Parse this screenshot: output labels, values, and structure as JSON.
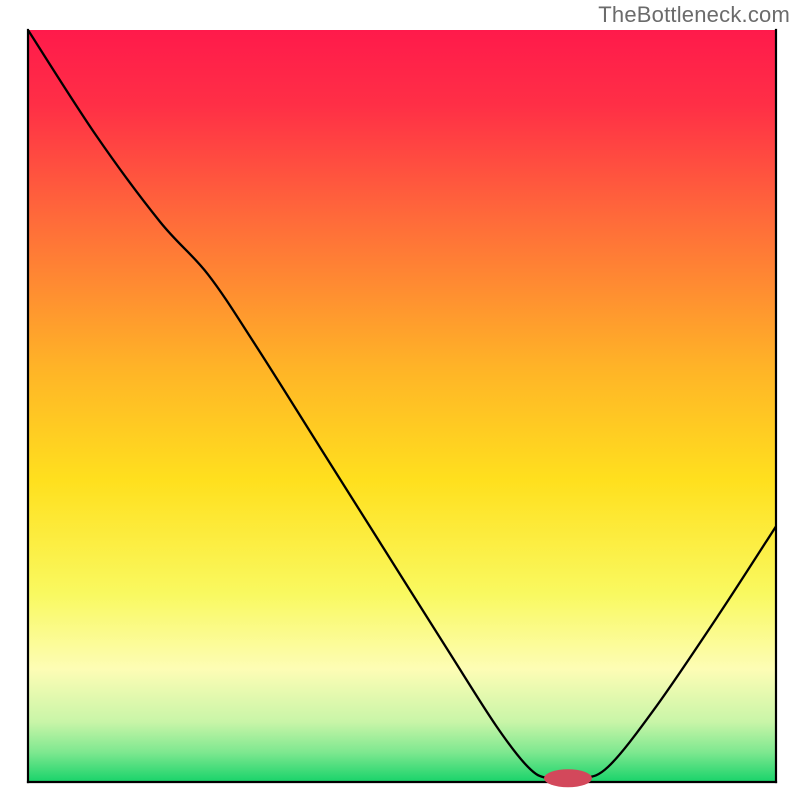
{
  "watermark": "TheBottleneck.com",
  "chart_data": {
    "type": "line",
    "title": "",
    "xlabel": "",
    "ylabel": "",
    "xlim": [
      0,
      100
    ],
    "ylim": [
      0,
      100
    ],
    "grid": false,
    "legend": false,
    "gradient_stops": [
      {
        "offset": 0.0,
        "color": "#ff1a4b"
      },
      {
        "offset": 0.1,
        "color": "#ff2f46"
      },
      {
        "offset": 0.25,
        "color": "#ff6a3a"
      },
      {
        "offset": 0.45,
        "color": "#ffb427"
      },
      {
        "offset": 0.6,
        "color": "#ffe01e"
      },
      {
        "offset": 0.75,
        "color": "#f9f960"
      },
      {
        "offset": 0.85,
        "color": "#fdfdb5"
      },
      {
        "offset": 0.92,
        "color": "#c9f5a8"
      },
      {
        "offset": 0.96,
        "color": "#7fe890"
      },
      {
        "offset": 1.0,
        "color": "#18d36a"
      }
    ],
    "curve_points": [
      {
        "x": 3.5,
        "y": 100.0
      },
      {
        "x": 12.0,
        "y": 86.0
      },
      {
        "x": 20.0,
        "y": 74.5
      },
      {
        "x": 26.0,
        "y": 67.5
      },
      {
        "x": 32.0,
        "y": 58.0
      },
      {
        "x": 40.0,
        "y": 44.5
      },
      {
        "x": 48.0,
        "y": 31.0
      },
      {
        "x": 56.0,
        "y": 17.5
      },
      {
        "x": 62.0,
        "y": 7.5
      },
      {
        "x": 66.0,
        "y": 2.0
      },
      {
        "x": 68.5,
        "y": 0.5
      },
      {
        "x": 72.5,
        "y": 0.5
      },
      {
        "x": 76.0,
        "y": 2.0
      },
      {
        "x": 82.0,
        "y": 10.0
      },
      {
        "x": 90.0,
        "y": 22.5
      },
      {
        "x": 97.0,
        "y": 34.0
      }
    ],
    "marker": {
      "x": 71.0,
      "y": 0.5,
      "rx": 3.2,
      "ry": 1.2,
      "color": "#d3485b"
    },
    "axes": {
      "left_x": 3.5,
      "right_x": 97.0,
      "bottom_y": 0.0,
      "top_y": 100.0,
      "stroke": "#000000",
      "width": 2.2
    }
  }
}
